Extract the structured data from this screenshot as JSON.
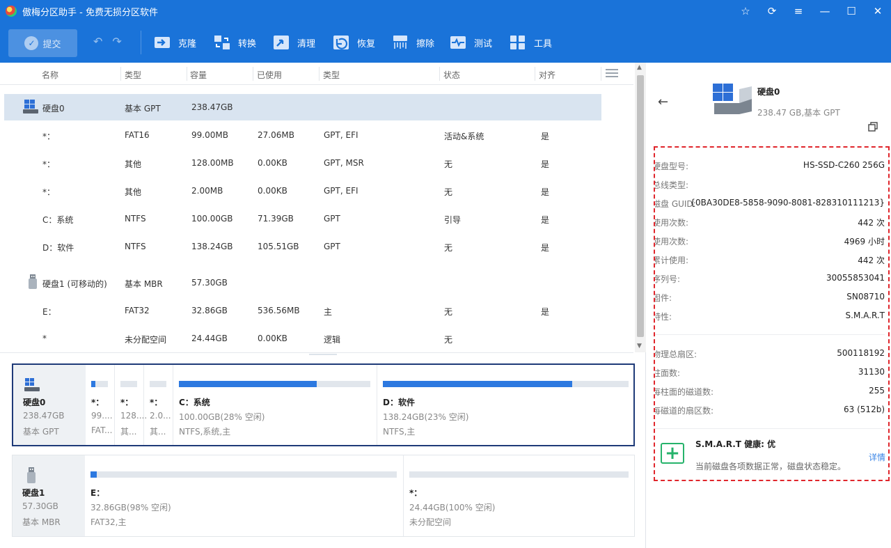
{
  "app": {
    "title": "傲梅分区助手 - 免费无损分区软件"
  },
  "window_controls": [
    "☆",
    "⟳",
    "≡",
    "—",
    "☐",
    "✕"
  ],
  "toolbar": {
    "submit_label": "提交",
    "tools": [
      {
        "label": "克隆",
        "icon": "clone-icon"
      },
      {
        "label": "转换",
        "icon": "convert-icon"
      },
      {
        "label": "清理",
        "icon": "clean-icon"
      },
      {
        "label": "恢复",
        "icon": "recover-icon"
      },
      {
        "label": "擦除",
        "icon": "wipe-icon"
      },
      {
        "label": "测试",
        "icon": "test-icon"
      },
      {
        "label": "工具",
        "icon": "tools-icon"
      }
    ]
  },
  "table": {
    "headers": [
      "名称",
      "类型",
      "容量",
      "已使用",
      "类型",
      "状态",
      "对齐"
    ],
    "rows": [
      {
        "kind": "disk",
        "icon": "disk-icon",
        "name": "硬盘0",
        "type": "基本 GPT",
        "capacity": "238.47GB",
        "used": "",
        "ptype": "",
        "status": "",
        "align": "",
        "selected": true
      },
      {
        "kind": "part",
        "name": "*：",
        "type": "FAT16",
        "capacity": "99.00MB",
        "used": "27.06MB",
        "ptype": "GPT, EFI",
        "status": "活动&系统",
        "align": "是"
      },
      {
        "kind": "part",
        "name": "*：",
        "type": "其他",
        "capacity": "128.00MB",
        "used": "0.00KB",
        "ptype": "GPT, MSR",
        "status": "无",
        "align": "是"
      },
      {
        "kind": "part",
        "name": "*：",
        "type": "其他",
        "capacity": "2.00MB",
        "used": "0.00KB",
        "ptype": "GPT, EFI",
        "status": "无",
        "align": "是"
      },
      {
        "kind": "part",
        "name": "C：系统",
        "type": "NTFS",
        "capacity": "100.00GB",
        "used": "71.39GB",
        "ptype": "GPT",
        "status": "引导",
        "align": "是"
      },
      {
        "kind": "part",
        "name": "D：软件",
        "type": "NTFS",
        "capacity": "138.24GB",
        "used": "105.51GB",
        "ptype": "GPT",
        "status": "无",
        "align": "是"
      },
      {
        "kind": "disk",
        "icon": "usb-icon",
        "name": "硬盘1 (可移动的)",
        "type": "基本 MBR",
        "capacity": "57.30GB",
        "used": "",
        "ptype": "",
        "status": "",
        "align": ""
      },
      {
        "kind": "part",
        "name": "E：",
        "type": "FAT32",
        "capacity": "32.86GB",
        "used": "536.56MB",
        "ptype": "主",
        "status": "无",
        "align": "是"
      },
      {
        "kind": "part",
        "name": "*",
        "type": "未分配空间",
        "capacity": "24.44GB",
        "used": "0.00KB",
        "ptype": "逻辑",
        "status": "无",
        "align": ""
      }
    ]
  },
  "disk_maps": [
    {
      "name": "硬盘0",
      "size": "238.47GB",
      "type": "基本 GPT",
      "icon": "disk-icon",
      "partitions": [
        {
          "name": "*：",
          "line1": "99....",
          "line2": "FAT...",
          "used_fraction": 0.27
        },
        {
          "name": "*：",
          "line1": "128....",
          "line2": "其...",
          "used_fraction": 0
        },
        {
          "name": "*：",
          "line1": "2.0...",
          "line2": "其...",
          "used_fraction": 0
        },
        {
          "name": "C：系统",
          "line1": "100.00GB(28% 空闲)",
          "line2": "NTFS,系统,主",
          "used_fraction": 0.72
        },
        {
          "name": "D：软件",
          "line1": "138.24GB(23% 空闲)",
          "line2": "NTFS,主",
          "used_fraction": 0.77
        }
      ]
    },
    {
      "name": "硬盘1",
      "size": "57.30GB",
      "type": "基本 MBR",
      "icon": "usb-icon",
      "partitions": [
        {
          "name": "E：",
          "line1": "32.86GB(98% 空闲)",
          "line2": "FAT32,主",
          "used_fraction": 0.02
        },
        {
          "name": "*：",
          "line1": "24.44GB(100% 空闲)",
          "line2": "未分配空间",
          "used_fraction": 0
        }
      ]
    }
  ],
  "details_panel": {
    "title": "硬盘0",
    "subtitle": "238.47 GB,基本 GPT",
    "fields": [
      {
        "k": "硬盘型号:",
        "v": "HS-SSD-C260 256G"
      },
      {
        "k": "总线类型:",
        "v": ""
      },
      {
        "k": "磁盘 GUID:",
        "v": "{0BA30DE8-5858-9090-8081-828310111213}"
      },
      {
        "k": "使用次数:",
        "v": "442 次"
      },
      {
        "k": "使用次数:",
        "v": "4969 小时"
      },
      {
        "k": "累计使用:",
        "v": "442 次"
      },
      {
        "k": "序列号:",
        "v": "30055853041"
      },
      {
        "k": "固件:",
        "v": "SN08710"
      },
      {
        "k": "特性:",
        "v": "S.M.A.R.T"
      }
    ],
    "geometry_fields": [
      {
        "k": "物理总扇区:",
        "v": "500118192"
      },
      {
        "k": "柱面数:",
        "v": "31130"
      },
      {
        "k": "每柱面的磁道数:",
        "v": "255"
      },
      {
        "k": "每磁道的扇区数:",
        "v": "63 (512b)"
      }
    ],
    "smart": {
      "title": "S.M.A.R.T 健康: 优",
      "desc": "当前磁盘各项数据正常，磁盘状态稳定。",
      "link": "详情"
    }
  },
  "colors": {
    "accent": "#1a73d9",
    "bar_fill": "#2d79e0",
    "selected_row": "#d9e4f0",
    "highlight_dash": "#e0252b",
    "smart_green": "#26b36b"
  }
}
